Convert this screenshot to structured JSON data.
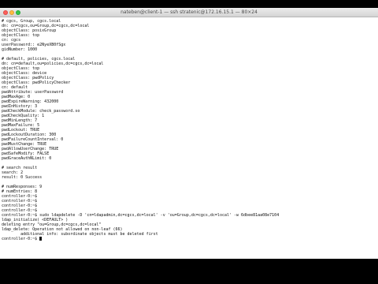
{
  "window": {
    "title": "nateben@client-1 — ssh stratenic@172.16.15.1 — 80×24"
  },
  "terminal": {
    "lines": [
      "# cgcs, Group, cgcs.local",
      "dn: cn=cgcs,ou=Group,dc=cgcs,dc=local",
      "objectClass: posixGroup",
      "objectClass: top",
      "cn: cgcs",
      "userPassword:: e2NyeXB0fSgx",
      "gidNumber: 1000",
      "",
      "# default, policies, cgcs.local",
      "dn: cn=default,ou=policies,dc=cgcs,dc=local",
      "objectClass: top",
      "objectClass: device",
      "objectClass: pwdPolicy",
      "objectClass: pwdPolicyChecker",
      "cn: default",
      "pwdAttribute: userPassword",
      "pwdMaxAge: 0",
      "pwdExpireWarning: 432000",
      "pwdInHistory: 3",
      "pwdCheckModule: check_password.so",
      "pwdCheckQuality: 1",
      "pwdMinLength: 7",
      "pwdMaxFailure: 5",
      "pwdLockout: TRUE",
      "pwdLockoutDuration: 300",
      "pwdFailureCountInterval: 0",
      "pwdMustChange: TRUE",
      "pwdAllowUserChange: TRUE",
      "pwdSafeModify: FALSE",
      "pwdGraceAuthNLimit: 0",
      "",
      "# search result",
      "search: 2",
      "result: 0 Success",
      "",
      "# numResponses: 9",
      "# numEntries: 8",
      "controller-0:~$",
      "controller-0:~$",
      "controller-0:~$",
      "controller-0:~$",
      "controller-0:~$ sudo ldapdelete -D 'cn=ldapadmin,dc=cgcs,dc=local' -v 'ou=Group,dc=cgcs,dc=local' -w 6dbee81aa08e7104",
      "ldap_initialize( <DEFAULT> )",
      "deleting entry \"ou=Group,dc=cgcs,dc=local\"",
      "ldap_delete: Operation not allowed on non-leaf (66)",
      "        additional info: subordinate objects must be deleted first",
      "controller-0:~$ "
    ]
  }
}
